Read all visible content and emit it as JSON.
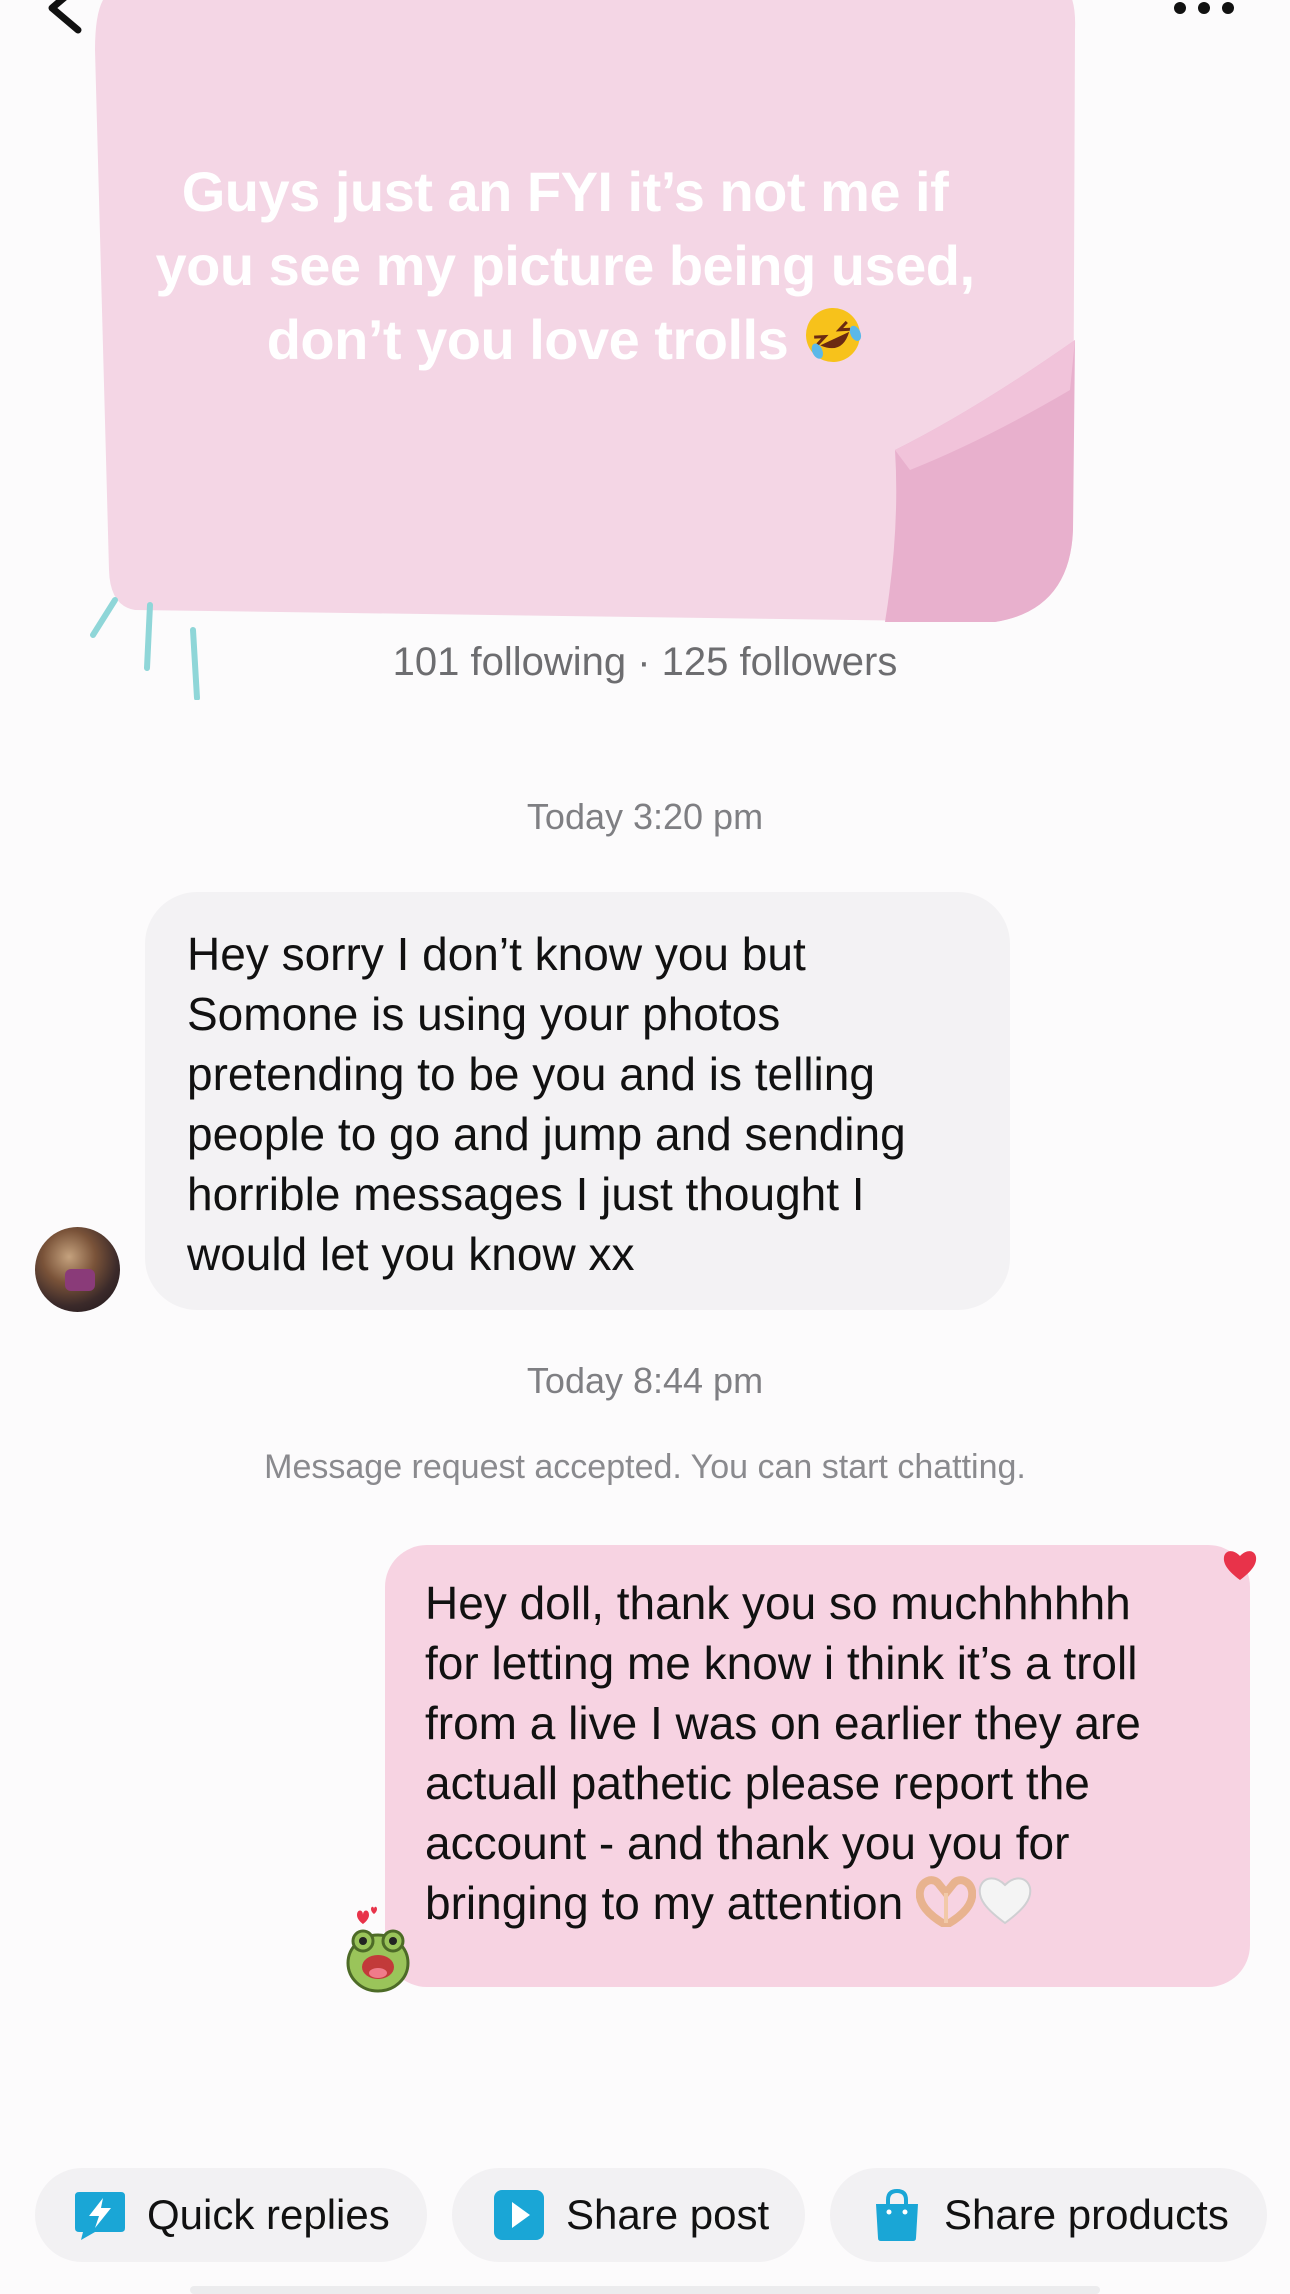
{
  "header": {
    "back_icon": "chevron-left-icon",
    "more_icon": "more-horizontal-icon"
  },
  "profile": {
    "username_partial": "@",
    "stats": "101 following · 125 followers"
  },
  "sticker_post": {
    "text": "Guys just an FYI it’s not me if you see my picture being used, don’t you love trolls",
    "emoji": "rolling-on-floor-laughing"
  },
  "conversation": {
    "timestamp_1": "Today 3:20 pm",
    "incoming_message": "Hey sorry I don’t know you but\nSomone is using your photos\npretending to be you and is telling\npeople to go and jump and sending\nhorrible messages I just thought I\nwould let you know xx",
    "timestamp_2": "Today 8:44 pm",
    "request_note": "Message request accepted. You can start chatting.",
    "outgoing_message": "Hey doll, thank you so muchhhhhh\nfor letting me know i think it’s a troll\nfrom a live I was on earlier they are\nactuall pathetic please report the\naccount - and thank you you for\nbringing to my attention",
    "outgoing_emojis": [
      "heart-hands",
      "white-heart"
    ],
    "reaction": "red-heart"
  },
  "quick_actions": {
    "quick_replies": "Quick replies",
    "share_post": "Share post",
    "share_products": "Share products"
  },
  "colors": {
    "incoming_bubble": "#f3f2f4",
    "outgoing_bubble": "#f7d3e2",
    "sticker_pink": "#f4d6e5",
    "accent_blue": "#1aa6d6",
    "reaction_red": "#e8334a"
  }
}
